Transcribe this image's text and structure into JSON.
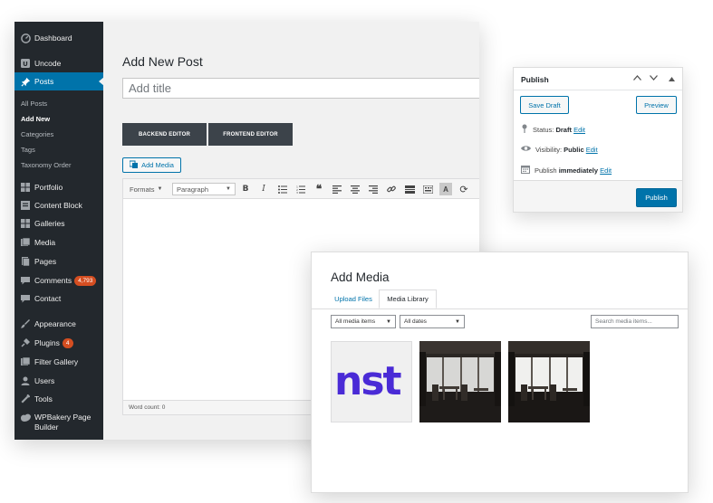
{
  "sidebar": {
    "items": [
      {
        "label": "Dashboard",
        "icon": "dashboard-icon"
      },
      {
        "label": "Uncode",
        "icon": "uncode-icon"
      },
      {
        "label": "Posts",
        "icon": "pin-icon"
      },
      {
        "label": "Portfolio",
        "icon": "portfolio-icon"
      },
      {
        "label": "Content Block",
        "icon": "content-block-icon"
      },
      {
        "label": "Galleries",
        "icon": "galleries-icon"
      },
      {
        "label": "Media",
        "icon": "media-icon"
      },
      {
        "label": "Pages",
        "icon": "pages-icon"
      },
      {
        "label": "Comments",
        "icon": "comments-icon",
        "badge": "4,793"
      },
      {
        "label": "Contact",
        "icon": "mail-icon"
      },
      {
        "label": "Appearance",
        "icon": "brush-icon"
      },
      {
        "label": "Plugins",
        "icon": "plugin-icon",
        "badge": "4"
      },
      {
        "label": "Filter Gallery",
        "icon": "filter-gallery-icon"
      },
      {
        "label": "Users",
        "icon": "users-icon"
      },
      {
        "label": "Tools",
        "icon": "wrench-icon"
      },
      {
        "label": "WPBakery Page Builder",
        "icon": "wpbakery-icon"
      }
    ],
    "posts_submenu": [
      "All Posts",
      "Add New",
      "Categories",
      "Tags",
      "Taxonomy Order"
    ],
    "active_item": "Posts",
    "current_submenu": "Add New"
  },
  "editor": {
    "page_title": "Add New Post",
    "title_placeholder": "Add title",
    "backend_editor_label": "BACKEND EDITOR",
    "frontend_editor_label": "FRONTEND EDITOR",
    "add_media_label": "Add Media",
    "formats_label": "Formats",
    "paragraph_label": "Paragraph",
    "word_count": "Word count: 0"
  },
  "publish": {
    "title": "Publish",
    "save_draft": "Save Draft",
    "preview": "Preview",
    "status_label": "Status:",
    "status_value": "Draft",
    "visibility_label": "Visibility:",
    "visibility_value": "Public",
    "publish_label": "Publish",
    "publish_value": "immediately",
    "edit_link": "Edit",
    "publish_button": "Publish"
  },
  "media_modal": {
    "title": "Add Media",
    "tabs": [
      "Upload Files",
      "Media Library"
    ],
    "active_tab": "Media Library",
    "filter_type": "All media items",
    "filter_date": "All dates",
    "search_placeholder": "Search media items...",
    "thumbnails": [
      {
        "name": "nst-logo",
        "text": "nst"
      },
      {
        "name": "dark-room-window-1"
      },
      {
        "name": "dark-room-window-2"
      }
    ]
  },
  "colors": {
    "sidebar_bg": "#23282d",
    "accent": "#0073aa",
    "badge": "#d54e21",
    "editor_button": "#3c434a",
    "logo_purple": "#4a2bd6"
  }
}
